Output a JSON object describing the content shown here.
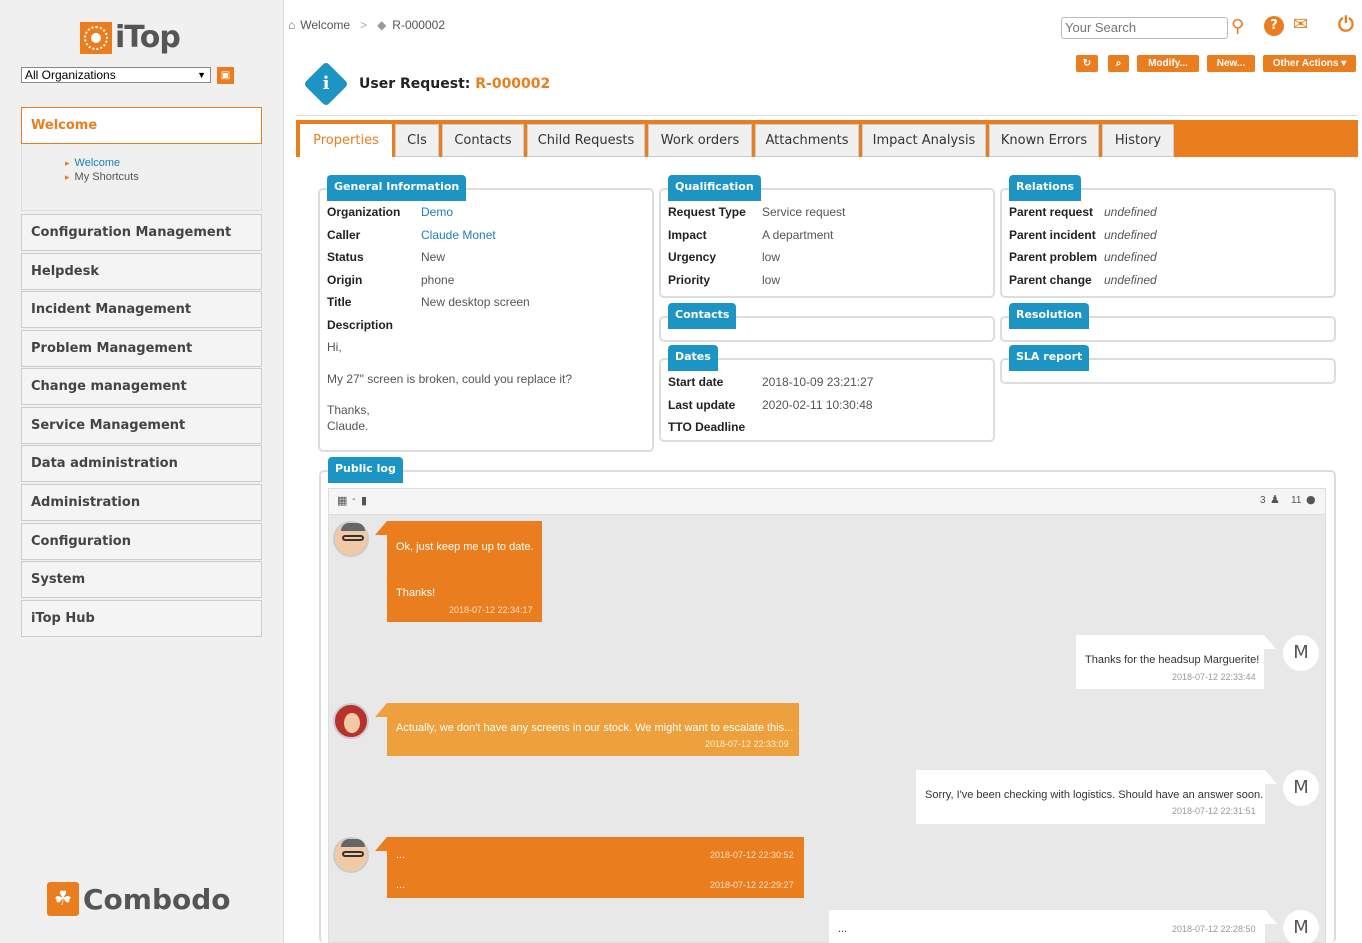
{
  "brand": {
    "name": "iTop",
    "footer": "Combodo"
  },
  "org_selector": {
    "value": "All Organizations"
  },
  "menu": {
    "welcome": "Welcome",
    "welcome_sub": [
      "Welcome",
      "My Shortcuts"
    ],
    "groups": [
      "Configuration Management",
      "Helpdesk",
      "Incident Management",
      "Problem Management",
      "Change management",
      "Service Management",
      "Data administration",
      "Administration",
      "Configuration",
      "System",
      "iTop Hub"
    ]
  },
  "breadcrumb": {
    "home": "Welcome",
    "current": "R-000002"
  },
  "search": {
    "placeholder": "Your Search"
  },
  "actions": {
    "refresh": "↻",
    "search": "⌕",
    "modify": "Modify...",
    "new": "New...",
    "other": "Other Actions ▾"
  },
  "title": {
    "prefix": "User Request:",
    "ref": "R-000002",
    "icon": "i"
  },
  "tabs": [
    "Properties",
    "CIs",
    "Contacts",
    "Child Requests",
    "Work orders",
    "Attachments",
    "Impact Analysis",
    "Known Errors",
    "History"
  ],
  "general": {
    "legend": "General Information",
    "labels": {
      "organization": "Organization",
      "caller": "Caller",
      "status": "Status",
      "origin": "Origin",
      "title": "Title",
      "description": "Description"
    },
    "values": {
      "organization": "Demo",
      "caller": "Claude Monet",
      "status": "New",
      "origin": "phone",
      "title": "New desktop screen"
    },
    "description": [
      "Hi,",
      "My 27\" screen is broken, could you replace it?",
      "Thanks,",
      "Claude."
    ]
  },
  "qualification": {
    "legend": "Qualification",
    "labels": {
      "request_type": "Request Type",
      "impact": "Impact",
      "urgency": "Urgency",
      "priority": "Priority"
    },
    "values": {
      "request_type": "Service request",
      "impact": "A department",
      "urgency": "low",
      "priority": "low"
    }
  },
  "contacts": {
    "legend": "Contacts"
  },
  "dates": {
    "legend": "Dates",
    "labels": {
      "start": "Start date",
      "last_update": "Last update",
      "tto": "TTO Deadline"
    },
    "values": {
      "start": "2018-10-09 23:21:27",
      "last_update": "2020-02-11 10:30:48"
    }
  },
  "relations": {
    "legend": "Relations",
    "labels": {
      "parent_request": "Parent request",
      "parent_incident": "Parent incident",
      "parent_problem": "Parent problem",
      "parent_change": "Parent change"
    },
    "value": "undefined"
  },
  "resolution": {
    "legend": "Resolution"
  },
  "sla": {
    "legend": "SLA report"
  },
  "public_log": {
    "legend": "Public log",
    "toolbar": {
      "users": "3",
      "messages": "11"
    },
    "entries": [
      {
        "text": "Ok, just keep me up to date.",
        "text2": "Thanks!",
        "ts": "2018-07-12 22:34:17"
      },
      {
        "text": "Thanks for the headsup Marguerite!",
        "ts": "2018-07-12 22:33:44",
        "avatar": "M"
      },
      {
        "text": "Actually, we don't have any screens in our stock. We might want to escalate this...",
        "ts": "2018-07-12 22:33:09"
      },
      {
        "text": "Sorry, I've been checking with logistics. Should have an answer soon.",
        "ts": "2018-07-12 22:31:51",
        "avatar": "M"
      },
      {
        "text": "...",
        "ts": "2018-07-12 22:30:52",
        "text2": "...",
        "ts2": "2018-07-12 22:29:27"
      },
      {
        "text": "...",
        "ts": "2018-07-12 22:28:50",
        "avatar": "M"
      }
    ]
  },
  "colors": {
    "accent": "#ea7d1e",
    "legend": "#1c94c4"
  }
}
